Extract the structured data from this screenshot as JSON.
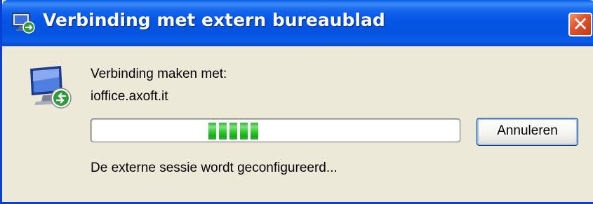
{
  "window": {
    "title": "Verbinding met extern bureaublad",
    "close_icon": "close-icon"
  },
  "dialog": {
    "connecting_label": "Verbinding maken met:",
    "host": "ioffice.axoft.it",
    "status": "De externe sessie wordt geconfigureerd...",
    "cancel_label": "Annuleren",
    "progress_icon": "computer-remote-icon",
    "progress": {
      "style": "marquee",
      "active_blocks": 5
    }
  },
  "colors": {
    "titlebar": "#0554e3",
    "dialog_bg": "#ece9d8",
    "progress_fill": "#36d036",
    "close_button": "#e0552f"
  }
}
